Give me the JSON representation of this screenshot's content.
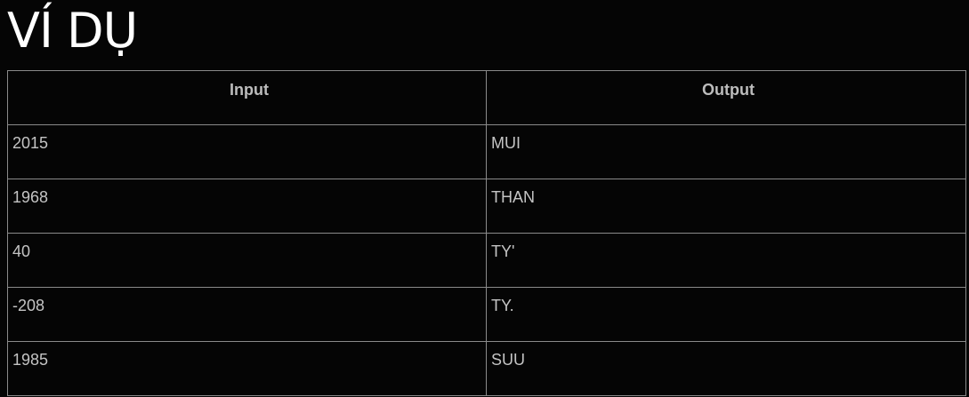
{
  "page": {
    "title": "VÍ DỤ"
  },
  "table": {
    "headers": [
      "Input",
      "Output"
    ],
    "rows": [
      [
        "2015",
        "MUI"
      ],
      [
        "1968",
        "THAN"
      ],
      [
        "40",
        "TY'"
      ],
      [
        "-208",
        "TY."
      ],
      [
        "1985",
        "SUU"
      ]
    ]
  }
}
